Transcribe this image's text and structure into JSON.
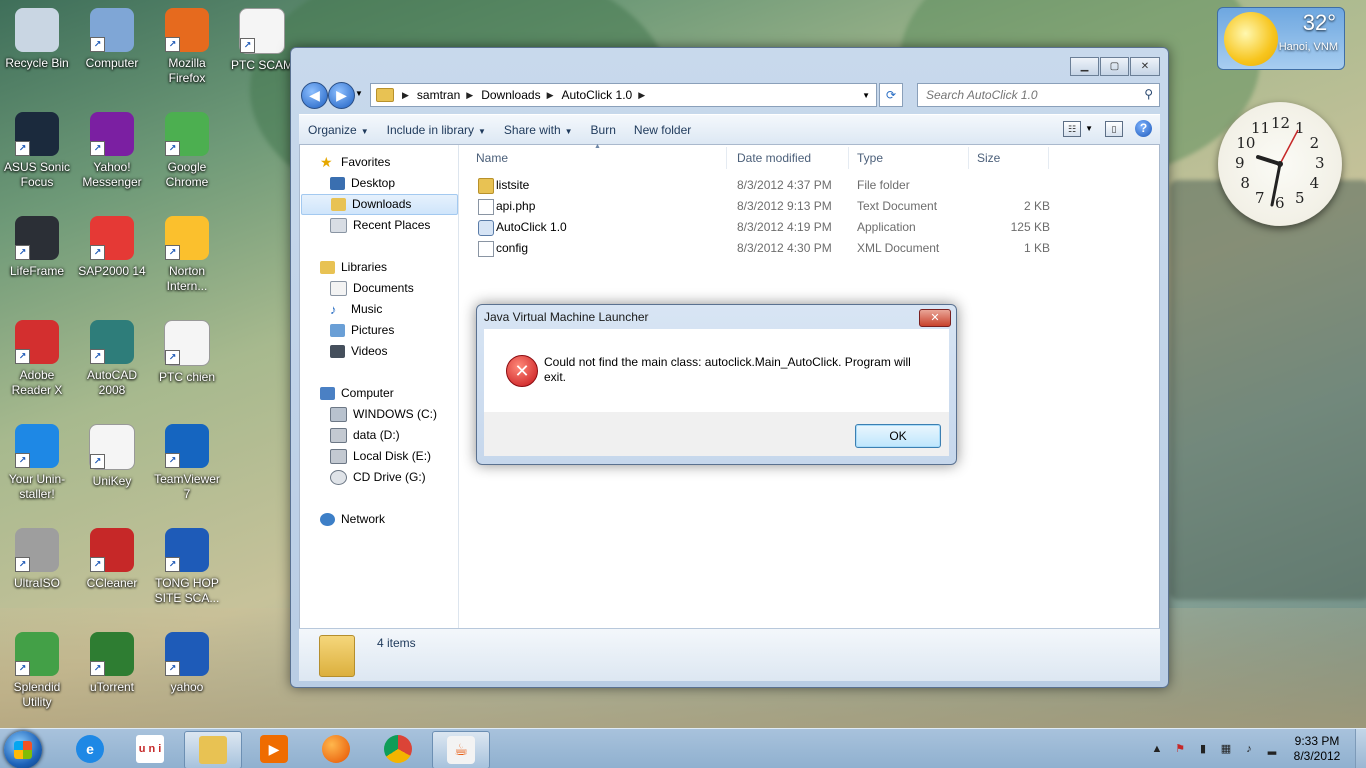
{
  "desktop_icons": [
    {
      "label": "Recycle Bin",
      "icon": "recycle-bin-icon",
      "color": "#c9d6e3"
    },
    {
      "label": "Computer",
      "icon": "computer-icon",
      "color": "#7fa6d6"
    },
    {
      "label": "Mozilla Firefox",
      "icon": "firefox-icon",
      "color": "#e66a1e"
    },
    {
      "label": "PTC SCAM",
      "icon": "text-file-icon",
      "color": "#f5f5f5"
    },
    {
      "label": "ASUS Sonic Focus",
      "icon": "asus-sonic-focus-icon",
      "color": "#1b2a3d"
    },
    {
      "label": "Yahoo! Messenger",
      "icon": "yahoo-messenger-icon",
      "color": "#7b1fa2"
    },
    {
      "label": "Google Chrome",
      "icon": "chrome-icon",
      "color": "#4caf50"
    },
    {
      "label": "LifeFrame",
      "icon": "webcam-icon",
      "color": "#2b2f36"
    },
    {
      "label": "SAP2000 14",
      "icon": "sap2000-icon",
      "color": "#e53935"
    },
    {
      "label": "Norton Intern...",
      "icon": "norton-icon",
      "color": "#fbc02d"
    },
    {
      "label": "Adobe Reader X",
      "icon": "adobe-reader-icon",
      "color": "#d32f2f"
    },
    {
      "label": "AutoCAD 2008",
      "icon": "autocad-icon",
      "color": "#2e7d7a"
    },
    {
      "label": "PTC chien",
      "icon": "text-file-icon",
      "color": "#f5f5f5"
    },
    {
      "label": "Your Unin-staller!",
      "icon": "uninstaller-icon",
      "color": "#1e88e5"
    },
    {
      "label": "UniKey",
      "icon": "unikey-icon",
      "color": "#f5f5f5"
    },
    {
      "label": "TeamViewer 7",
      "icon": "teamviewer-icon",
      "color": "#1565c0"
    },
    {
      "label": "UltraISO",
      "icon": "ultraiso-icon",
      "color": "#9e9e9e"
    },
    {
      "label": "CCleaner",
      "icon": "ccleaner-icon",
      "color": "#c62828"
    },
    {
      "label": "TONG HOP SITE SCA...",
      "icon": "word-document-icon",
      "color": "#1e5bb8"
    },
    {
      "label": "Splendid Utility",
      "icon": "splendid-utility-icon",
      "color": "#43a047"
    },
    {
      "label": "uTorrent",
      "icon": "utorrent-icon",
      "color": "#2e7d32"
    },
    {
      "label": "yahoo",
      "icon": "word-document-icon",
      "color": "#1e5bb8"
    }
  ],
  "explorer": {
    "address": {
      "crumbs": [
        "samtran",
        "Downloads",
        "AutoClick 1.0"
      ]
    },
    "search_placeholder": "Search AutoClick 1.0",
    "toolbar": {
      "organize": "Organize",
      "include": "Include in library",
      "share": "Share with",
      "burn": "Burn",
      "new_folder": "New folder"
    },
    "nav": {
      "favorites": "Favorites",
      "desktop": "Desktop",
      "downloads": "Downloads",
      "recent": "Recent Places",
      "libraries": "Libraries",
      "documents": "Documents",
      "music": "Music",
      "pictures": "Pictures",
      "videos": "Videos",
      "computer": "Computer",
      "c_drive": "WINDOWS (C:)",
      "d_drive": "data (D:)",
      "e_drive": "Local Disk (E:)",
      "g_drive": "CD Drive (G:)",
      "network": "Network"
    },
    "columns": {
      "name": "Name",
      "date": "Date modified",
      "type": "Type",
      "size": "Size"
    },
    "files": [
      {
        "name": "listsite",
        "date": "8/3/2012 4:37 PM",
        "type": "File folder",
        "size": "",
        "icon": "folder-icon"
      },
      {
        "name": "api.php",
        "date": "8/3/2012 9:13 PM",
        "type": "Text Document",
        "size": "2 KB",
        "icon": "text-file-icon"
      },
      {
        "name": "AutoClick 1.0",
        "date": "8/3/2012 4:19 PM",
        "type": "Application",
        "size": "125 KB",
        "icon": "application-icon"
      },
      {
        "name": "config",
        "date": "8/3/2012 4:30 PM",
        "type": "XML Document",
        "size": "1 KB",
        "icon": "xml-file-icon"
      }
    ],
    "status": "4 items"
  },
  "dialog": {
    "title": "Java Virtual Machine Launcher",
    "message": "Could not find the main class: autoclick.Main_AutoClick. Program will exit.",
    "ok": "OK"
  },
  "weather": {
    "temp": "32°",
    "city": "Hanoi, VNM"
  },
  "clock_numbers": [
    "12",
    "1",
    "2",
    "3",
    "4",
    "5",
    "6",
    "7",
    "8",
    "9",
    "10",
    "11"
  ],
  "taskbar": {
    "time": "9:33 PM",
    "date": "8/3/2012",
    "pinned": [
      "internet-explorer-icon",
      "unikey-icon",
      "windows-explorer-icon",
      "media-player-icon",
      "firefox-icon",
      "chrome-icon",
      "java-icon"
    ]
  }
}
